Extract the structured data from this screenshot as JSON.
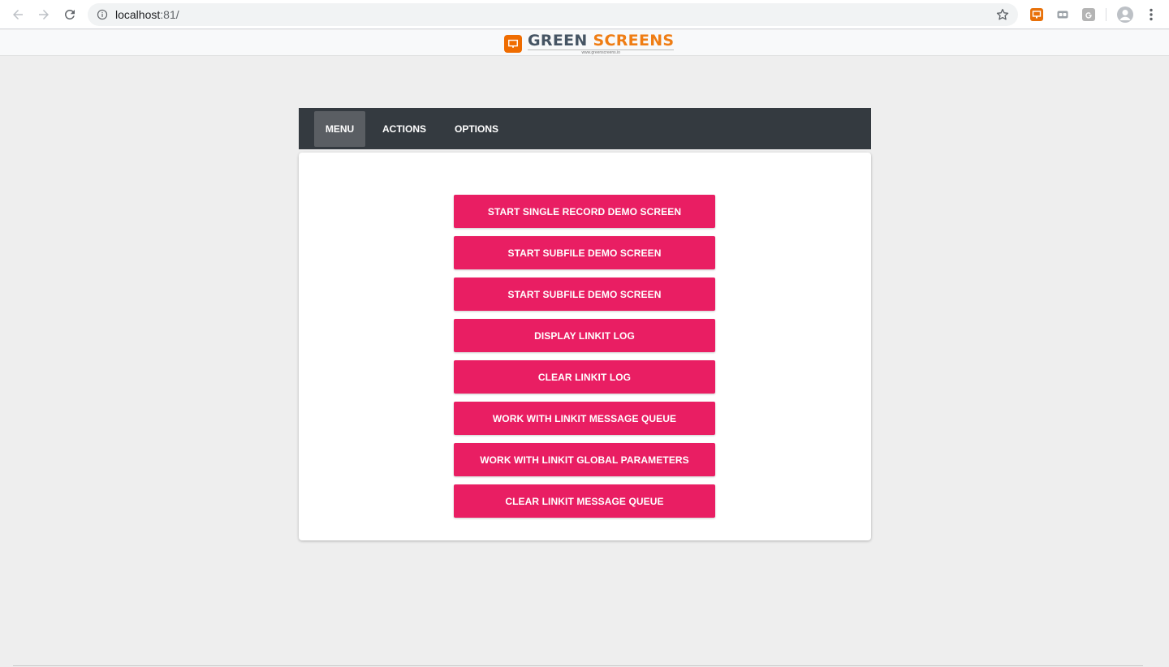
{
  "browser": {
    "url_host": "localhost",
    "url_port": ":81/"
  },
  "brand": {
    "name_part1": "GREEN",
    "name_part2": " SCREENS",
    "tagline": "www.greenscreens.io",
    "accent_color": "#ef7d14"
  },
  "toolbar": {
    "tabs": [
      {
        "label": "MENU",
        "active": true
      },
      {
        "label": "ACTIONS",
        "active": false
      },
      {
        "label": "OPTIONS",
        "active": false
      }
    ]
  },
  "menu": {
    "button_color": "#e91e63",
    "buttons": [
      {
        "label": "START SINGLE RECORD DEMO SCREEN"
      },
      {
        "label": "START SUBFILE DEMO SCREEN"
      },
      {
        "label": "START SUBFILE DEMO SCREEN"
      },
      {
        "label": "DISPLAY LINKIT LOG"
      },
      {
        "label": "CLEAR LINKIT LOG"
      },
      {
        "label": "WORK WITH LINKIT MESSAGE QUEUE"
      },
      {
        "label": "WORK WITH LINKIT GLOBAL PARAMETERS"
      },
      {
        "label": "CLEAR LINKIT MESSAGE QUEUE"
      }
    ]
  },
  "icons": {
    "back": "arrow-back-icon",
    "forward": "arrow-forward-icon",
    "reload": "reload-icon",
    "info": "info-icon",
    "bookmark": "star-icon",
    "menu": "more-vert-icon"
  }
}
